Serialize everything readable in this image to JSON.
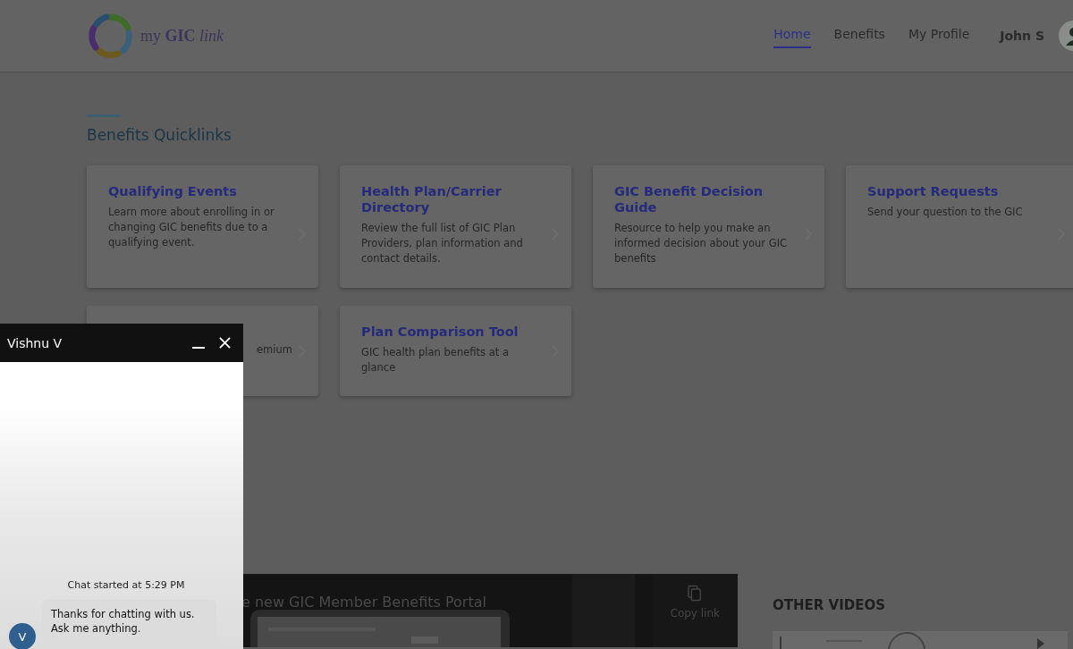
{
  "header": {
    "logo_text": "my **GIC** *link*",
    "nav": [
      {
        "label": "Home",
        "selected": true
      },
      {
        "label": "Benefits",
        "selected": false
      },
      {
        "label": "My Profile",
        "selected": false
      }
    ],
    "user": "John S"
  },
  "quicklinks": {
    "title": "Benefits Quicklinks",
    "cards": [
      {
        "title": "Qualifying Events",
        "description": "Learn more about enrolling in or changing GIC benefits due to a qualifying event."
      },
      {
        "title": "Health Plan/Carrier Directory",
        "description": "Review the full list of GIC Plan Providers, plan information and contact details."
      },
      {
        "title": "GIC Benefit Decision Guide",
        "description": "Resource to help you make an informed decision about your GIC benefits"
      },
      {
        "title": "Support Requests",
        "description": "Send your question to the GIC"
      },
      {
        "kind": "covered",
        "description": "emium"
      },
      {
        "title": "Plan Comparison Tool",
        "description": "GIC health plan benefits at a glance"
      }
    ]
  },
  "video": {
    "title": "e new GIC Member Benefits Portal",
    "copy_link": "Copy link",
    "other_videos": "OTHER VIDEOS"
  },
  "chat": {
    "title": "Vishnu V",
    "started": "Chat started at 5:29 PM",
    "messages": [
      {
        "avatar": "V",
        "text": "Thanks for chatting with us.\nAsk me anything."
      }
    ]
  }
}
